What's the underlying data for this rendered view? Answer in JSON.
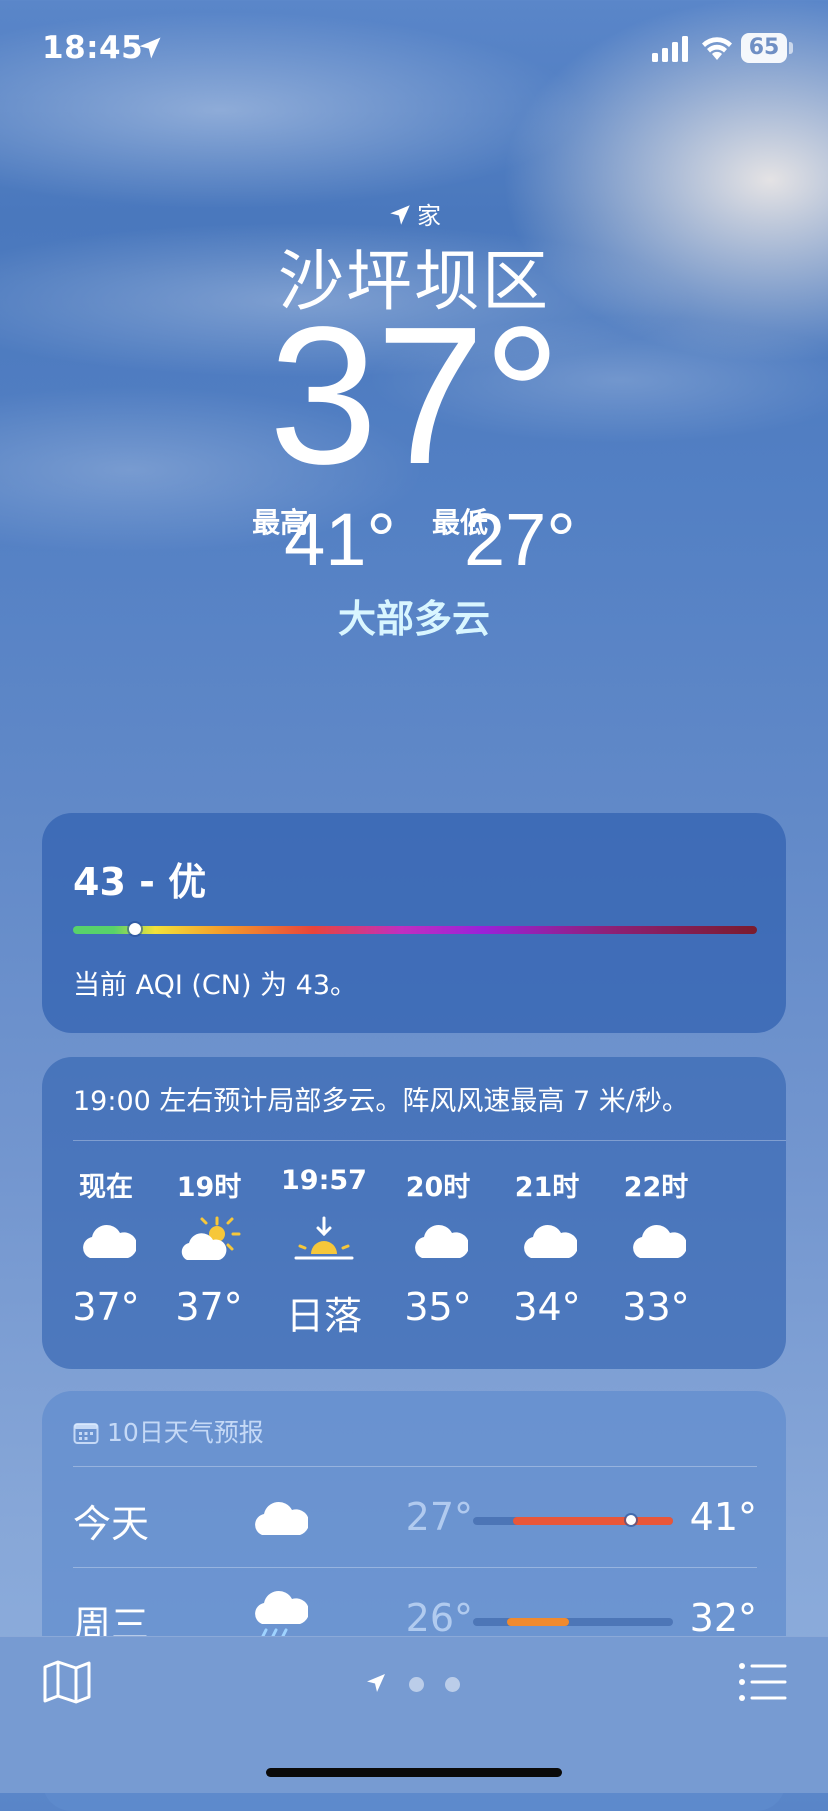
{
  "status_bar": {
    "time": "18:45",
    "battery": "65"
  },
  "location": {
    "home_label": "家",
    "city": "沙坪坝区",
    "temperature": "37°",
    "high_label": "最高",
    "high": "41°",
    "low_label": "最低",
    "low": "27°",
    "condition": "大部多云"
  },
  "aqi": {
    "value_label": "43 - 优",
    "level_fraction": 0.09,
    "description": "当前 AQI (CN) 为 43。",
    "scale_colors": [
      "#58d26a",
      "#f2e23a",
      "#f49b2b",
      "#e8453b",
      "#c02fc0",
      "#9a22d8",
      "#7a1c2e"
    ]
  },
  "hourly": {
    "summary": "19:00 左右预计局部多云。阵风风速最高 7 米/秒。",
    "items": [
      {
        "label": "现在",
        "icon": "cloud-icon",
        "value": "37°"
      },
      {
        "label": "19时",
        "icon": "partly-sunny-icon",
        "value": "37°"
      },
      {
        "label": "19:57",
        "icon": "sunset-icon",
        "value": "日落"
      },
      {
        "label": "20时",
        "icon": "cloud-icon",
        "value": "35°"
      },
      {
        "label": "21时",
        "icon": "cloud-icon",
        "value": "34°"
      },
      {
        "label": "22时",
        "icon": "cloud-icon",
        "value": "33°"
      }
    ]
  },
  "daily": {
    "header": "10日天气预报",
    "items": [
      {
        "day": "今天",
        "icon": "cloud-icon",
        "low": "27°",
        "high": "41°",
        "range_start": 0.2,
        "range_end": 1.0,
        "current": 0.79,
        "fill_color": "#e8573a"
      },
      {
        "day": "周三",
        "icon": "rain-cloud-icon",
        "low": "26°",
        "high": "32°",
        "range_start": 0.17,
        "range_end": 0.48,
        "current": null,
        "fill_color": "#f08a2e"
      }
    ]
  },
  "bottom_bar": {
    "map_icon": "map-icon",
    "location_icon": "location-arrow-icon",
    "list_icon": "list-icon"
  }
}
